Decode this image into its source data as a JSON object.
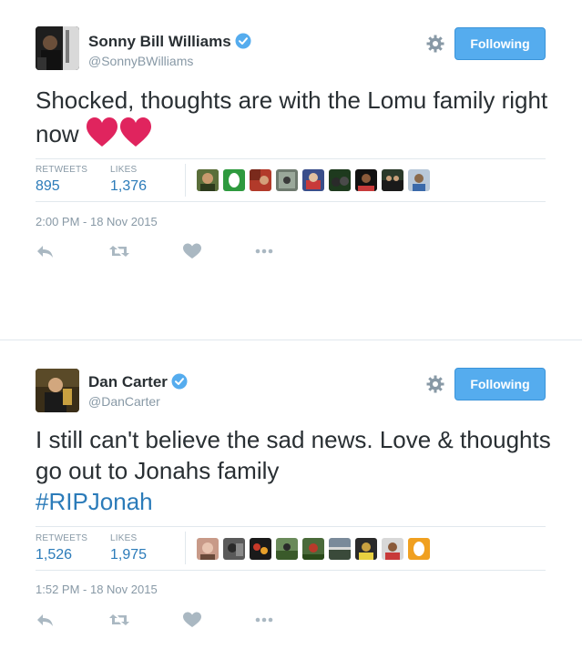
{
  "tweets": [
    {
      "name": "Sonny Bill Williams",
      "handle": "@SonnyBWilliams",
      "follow_label": "Following",
      "text": "Shocked, thoughts are with the Lomu family right now",
      "retweets_label": "RETWEETS",
      "retweets": "895",
      "likes_label": "LIKES",
      "likes": "1,376",
      "timestamp": "2:00 PM - 18 Nov 2015"
    },
    {
      "name": "Dan Carter",
      "handle": "@DanCarter",
      "follow_label": "Following",
      "text": "I still can't believe the sad news. Love & thoughts go out to Jonahs family",
      "hashtag": "#RIPJonah",
      "retweets_label": "RETWEETS",
      "retweets": "1,526",
      "likes_label": "LIKES",
      "likes": "1,975",
      "timestamp": "1:52 PM - 18 Nov 2015"
    }
  ],
  "colors": {
    "accent": "#55acee",
    "link": "#2b7bb9",
    "muted": "#8899a6",
    "heart": "#e0245e"
  },
  "icons": {
    "verified": "verified-badge-icon",
    "gear": "gear-icon",
    "reply": "reply-icon",
    "retweet": "retweet-icon",
    "like": "heart-icon",
    "more": "more-icon"
  }
}
